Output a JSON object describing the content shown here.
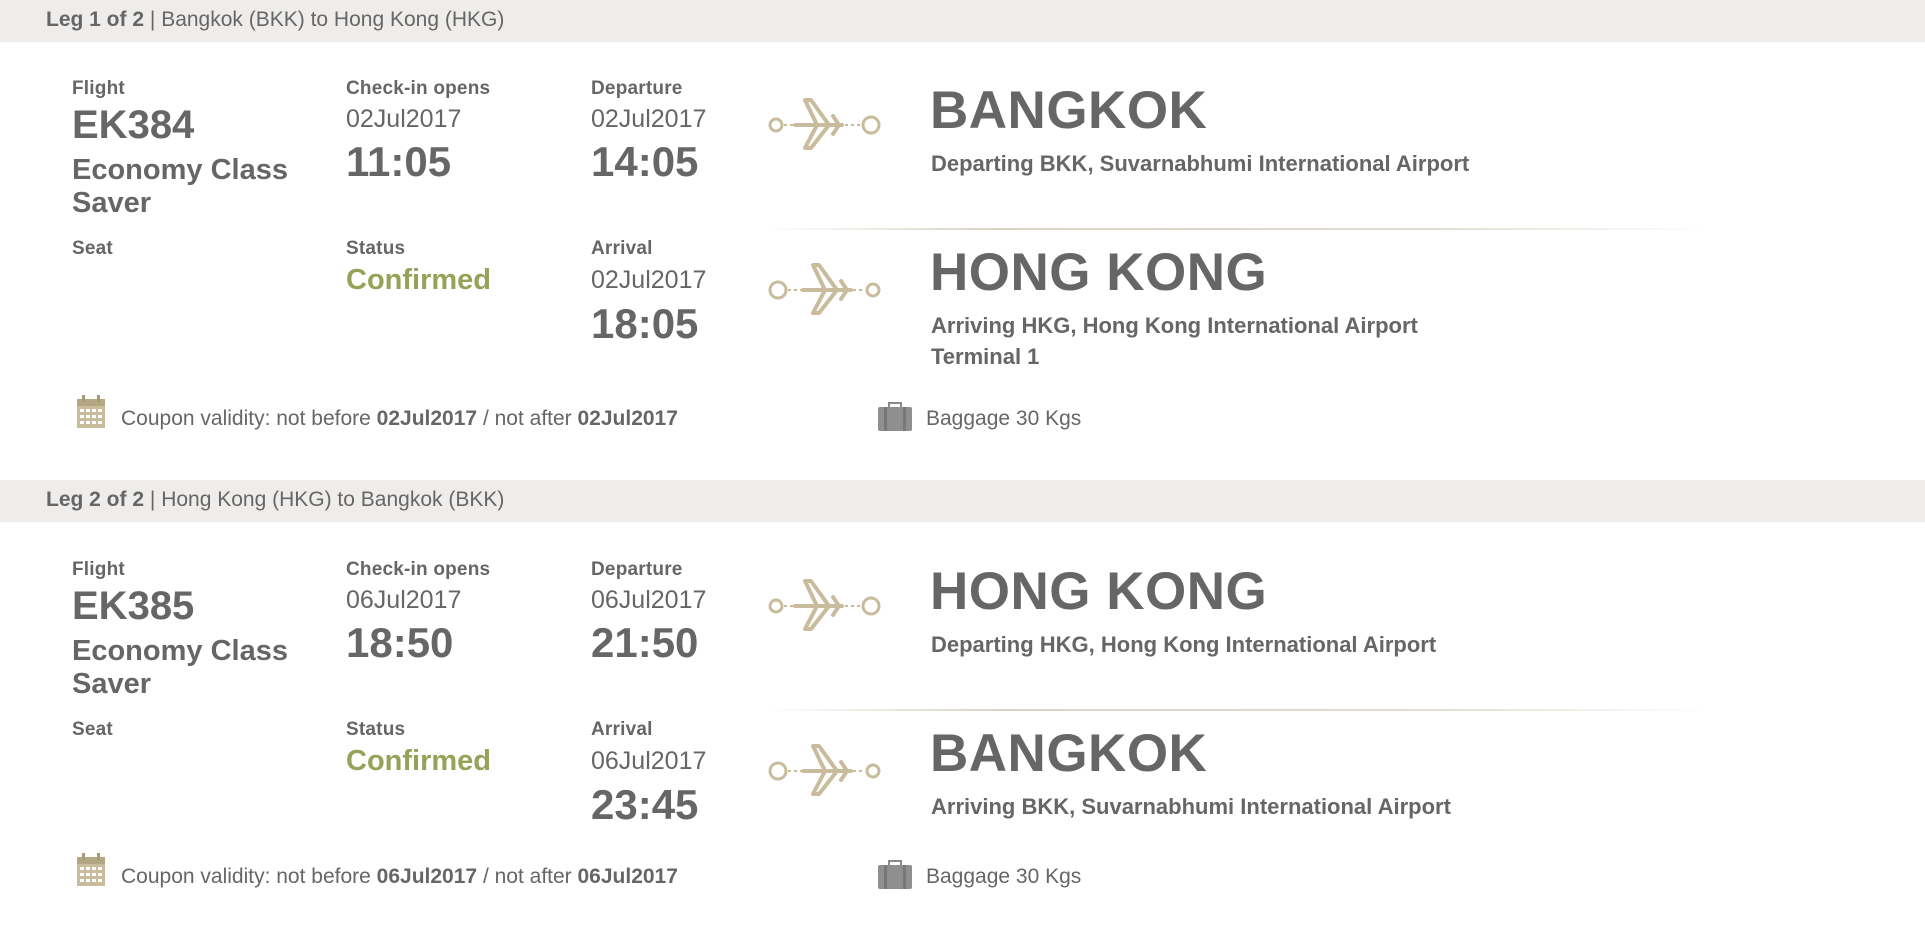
{
  "legs": [
    {
      "header": {
        "leg_label": "Leg 1 of 2",
        "separator": "|",
        "route": "Bangkok (BKK) to Hong Kong (HKG)"
      },
      "flight": {
        "label": "Flight",
        "number": "EK384",
        "cabin": "Economy Class Saver"
      },
      "checkin": {
        "label": "Check-in opens",
        "date": "02Jul2017",
        "time": "11:05"
      },
      "departure": {
        "label": "Departure",
        "date": "02Jul2017",
        "time": "14:05",
        "city": "BANGKOK",
        "airport": "Departing BKK, Suvarnabhumi International Airport"
      },
      "seat": {
        "label": "Seat"
      },
      "status": {
        "label": "Status",
        "value": "Confirmed"
      },
      "arrival": {
        "label": "Arrival",
        "date": "02Jul2017",
        "time": "18:05",
        "city": "HONG KONG",
        "airport": "Arriving HKG, Hong Kong International Airport",
        "terminal": "Terminal 1"
      },
      "coupon": {
        "prefix": "Coupon validity: not before",
        "not_before": "02Jul2017",
        "middle": "/ not after",
        "not_after": "02Jul2017"
      },
      "baggage": {
        "text": "Baggage 30 Kgs"
      }
    },
    {
      "header": {
        "leg_label": "Leg 2 of 2",
        "separator": "|",
        "route": "Hong Kong (HKG) to Bangkok (BKK)"
      },
      "flight": {
        "label": "Flight",
        "number": "EK385",
        "cabin": "Economy Class Saver"
      },
      "checkin": {
        "label": "Check-in opens",
        "date": "06Jul2017",
        "time": "18:50"
      },
      "departure": {
        "label": "Departure",
        "date": "06Jul2017",
        "time": "21:50",
        "city": "HONG KONG",
        "airport": "Departing HKG, Hong Kong International Airport"
      },
      "seat": {
        "label": "Seat"
      },
      "status": {
        "label": "Status",
        "value": "Confirmed"
      },
      "arrival": {
        "label": "Arrival",
        "date": "06Jul2017",
        "time": "23:45",
        "city": "BANGKOK",
        "airport": "Arriving BKK, Suvarnabhumi International Airport",
        "terminal": ""
      },
      "coupon": {
        "prefix": "Coupon validity: not before",
        "not_before": "06Jul2017",
        "middle": "/ not after",
        "not_after": "06Jul2017"
      },
      "baggage": {
        "text": "Baggage 30 Kgs"
      }
    }
  ],
  "icons": {
    "departure_plane": "plane-departure-icon",
    "arrival_plane": "plane-arrival-icon",
    "calendar": "calendar-icon",
    "baggage": "suitcase-icon"
  },
  "colors": {
    "header_bg": "#efedeb",
    "text": "#666666",
    "status_confirmed": "#97a259",
    "icon_gold": "#c9bc9c"
  }
}
